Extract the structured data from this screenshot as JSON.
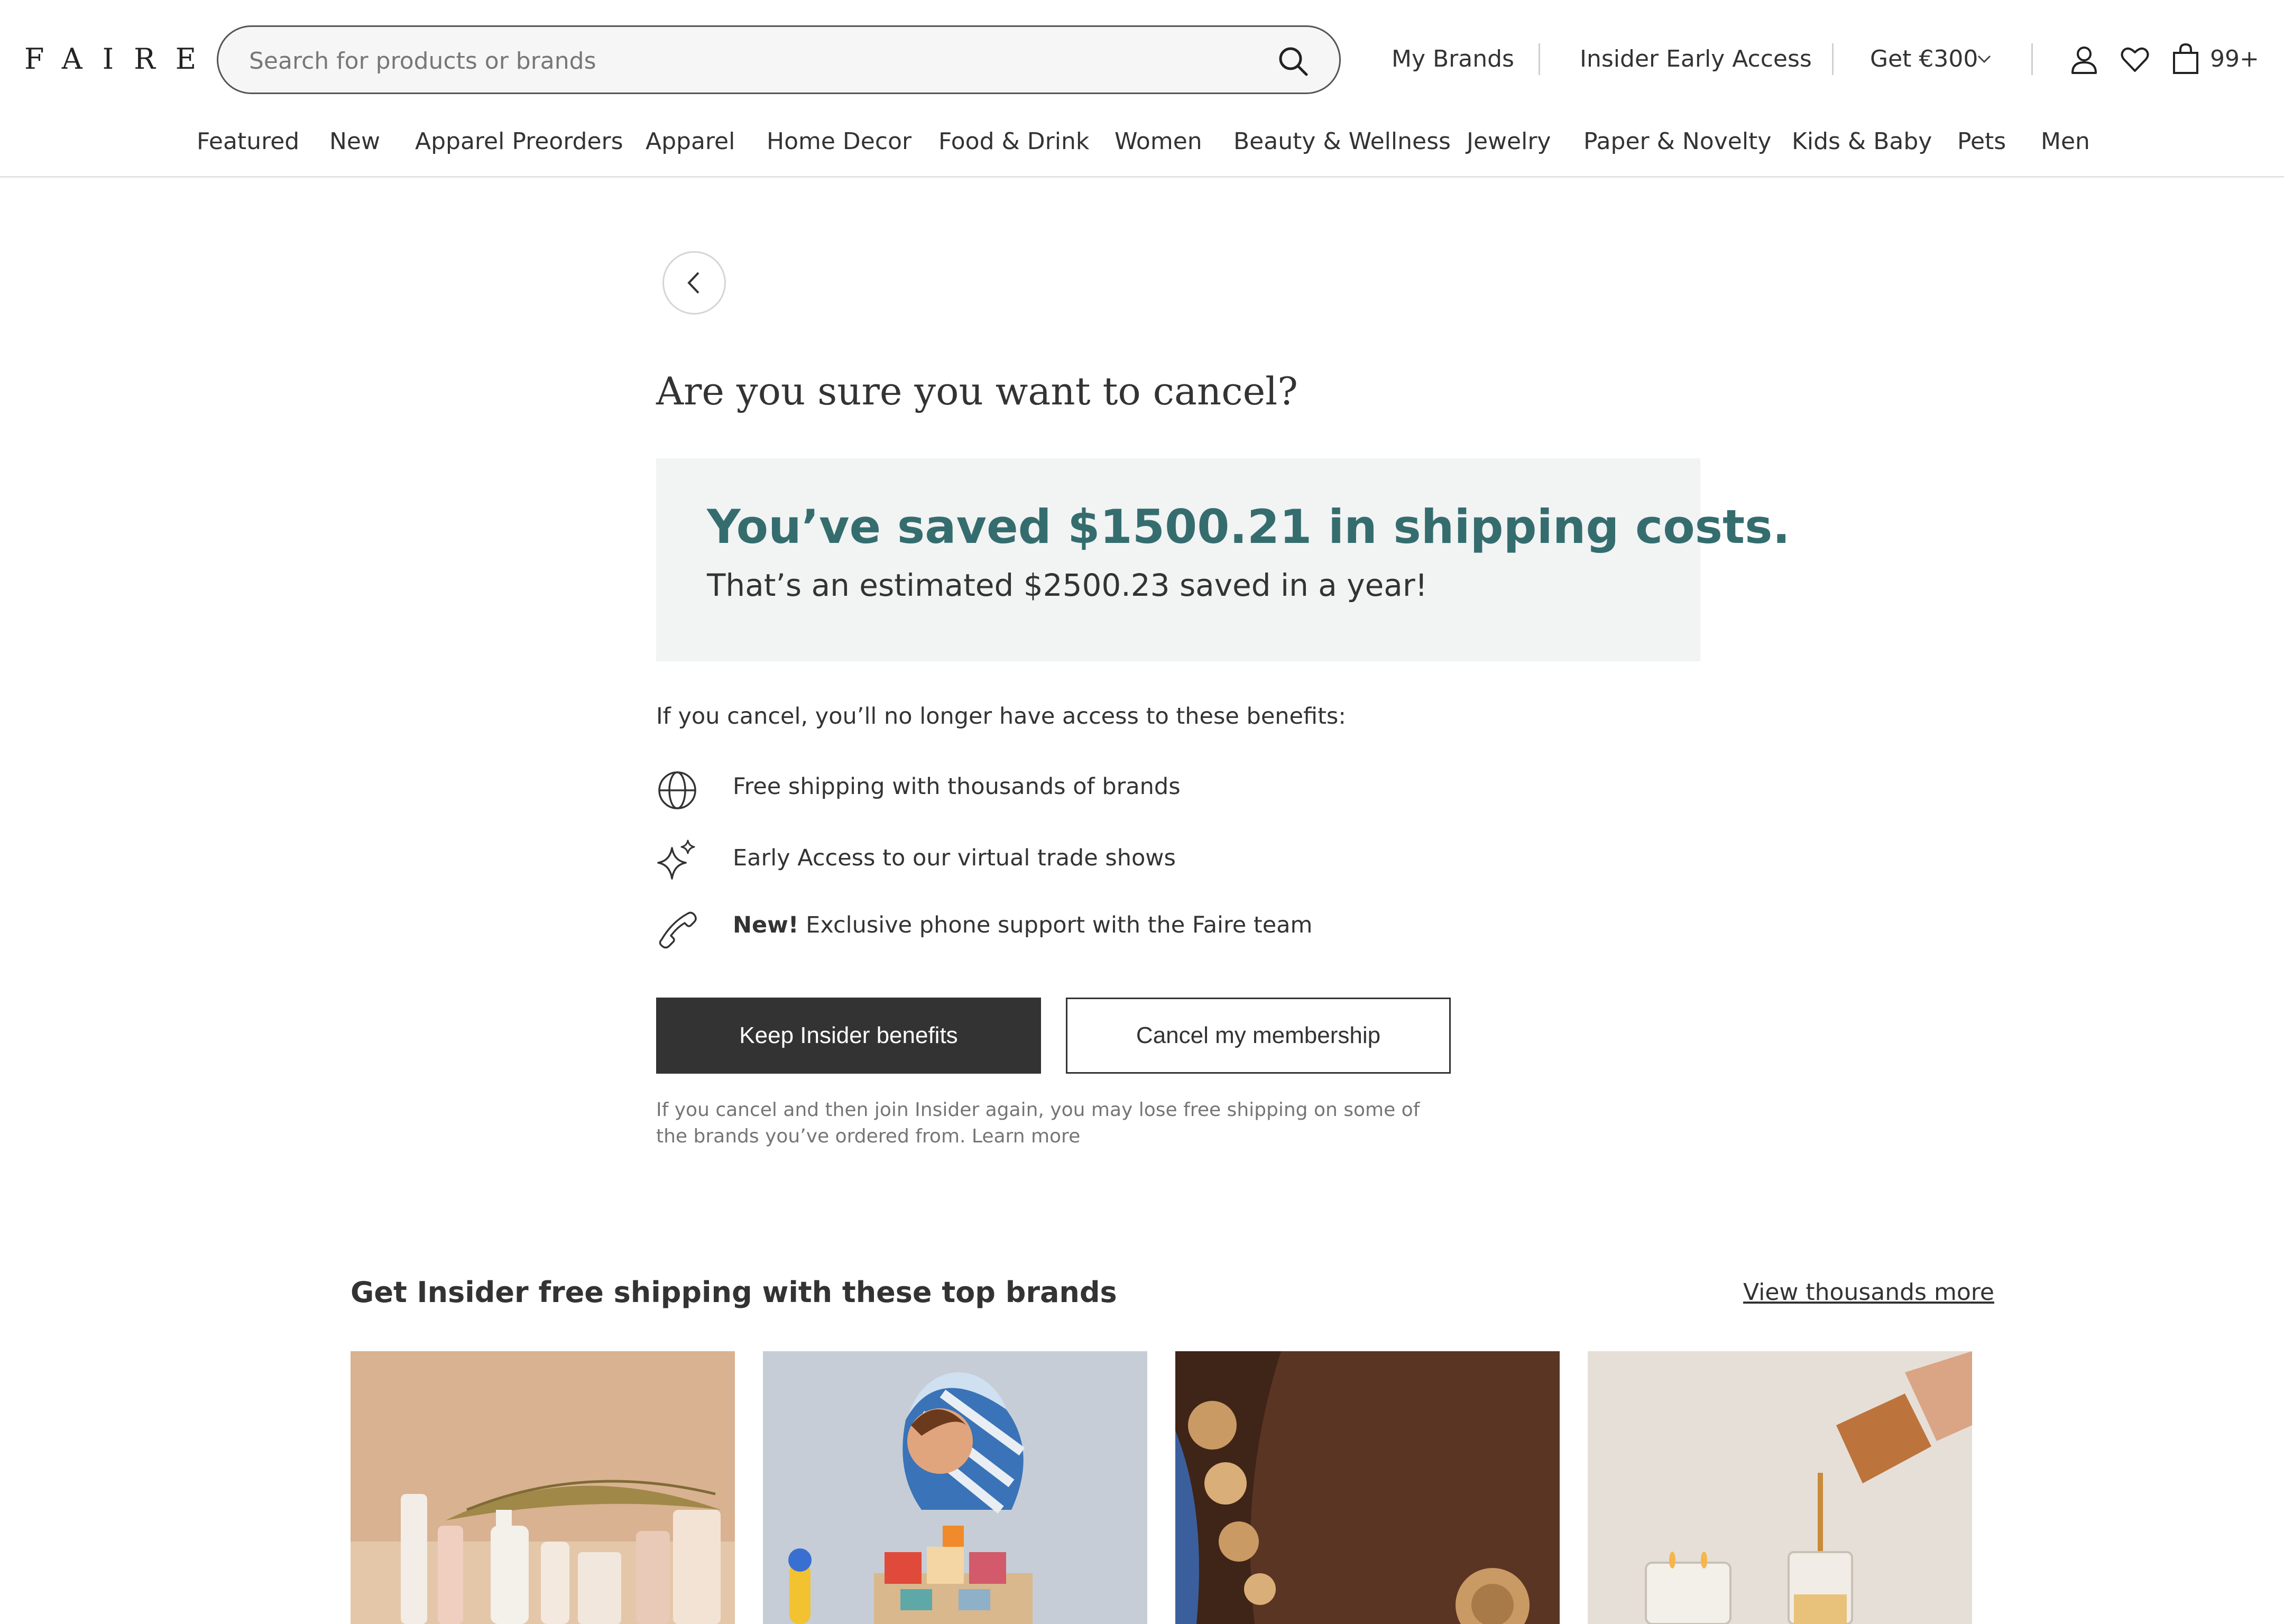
{
  "header": {
    "logo": "FAIRE",
    "search": {
      "placeholder": "Search for products or brands"
    },
    "links": [
      "My Brands",
      "Insider Early Access"
    ],
    "promo_label": "Get €300",
    "cart_count": "99+"
  },
  "categories": [
    "Featured",
    "New",
    "Apparel Preorders",
    "Apparel",
    "Home Decor",
    "Food & Drink",
    "Women",
    "Beauty & Wellness",
    "Jewelry",
    "Paper & Novelty",
    "Kids & Baby",
    "Pets",
    "Men"
  ],
  "main": {
    "title": "Are you sure you want to cancel?",
    "savings": {
      "headline": "You’ve saved $1500.21 in shipping costs.",
      "subline": "That’s an estimated $2500.23 saved in a year!"
    },
    "lead": "If you cancel, you’ll no longer have access to these benefits:",
    "benefits": [
      {
        "icon": "globe-icon",
        "prefix": "",
        "text": "Free shipping with thousands of brands"
      },
      {
        "icon": "sparkle-icon",
        "prefix": "",
        "text": "Early Access to our virtual trade shows"
      },
      {
        "icon": "phone-icon",
        "prefix": "New!",
        "text": " Exclusive phone support with the Faire team"
      }
    ],
    "keep_button": "Keep Insider benefits",
    "cancel_button": "Cancel my membership",
    "fine_print": "If you cancel and then join Insider again, you may lose free shipping on some of the brands you’ve ordered from. Learn more"
  },
  "brands": {
    "heading": "Get Insider free shipping with these top brands",
    "view_more": "View thousands more"
  },
  "colors": {
    "accent_teal": "#356d6f",
    "primary_button": "#333333",
    "savings_bg": "#f2f3f3"
  }
}
